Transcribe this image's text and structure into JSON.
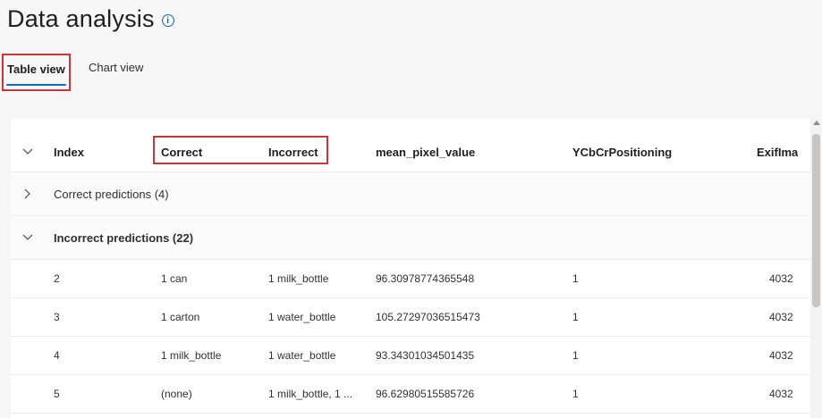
{
  "page": {
    "title": "Data analysis"
  },
  "tabs": [
    {
      "label": "Table view",
      "selected": true
    },
    {
      "label": "Chart view",
      "selected": false
    }
  ],
  "table": {
    "columns": [
      "Index",
      "Correct",
      "Incorrect",
      "mean_pixel_value",
      "YCbCrPositioning",
      "ExifIma"
    ],
    "groups": [
      {
        "label": "Correct predictions (4)",
        "expanded": false
      },
      {
        "label": "Incorrect predictions (22)",
        "expanded": true
      }
    ],
    "rows": [
      [
        "2",
        "1 can",
        "1 milk_bottle",
        "96.30978774365548",
        "1",
        "4032"
      ],
      [
        "3",
        "1 carton",
        "1 water_bottle",
        "105.27297036515473",
        "1",
        "4032"
      ],
      [
        "4",
        "1 milk_bottle",
        "1 water_bottle",
        "93.34301034501435",
        "1",
        "4032"
      ],
      [
        "5",
        "(none)",
        "1 milk_bottle, 1 ...",
        "96.62980515585726",
        "1",
        "4032"
      ]
    ]
  },
  "colors": {
    "accent": "#0f6cbd",
    "highlight": "#d13438"
  }
}
